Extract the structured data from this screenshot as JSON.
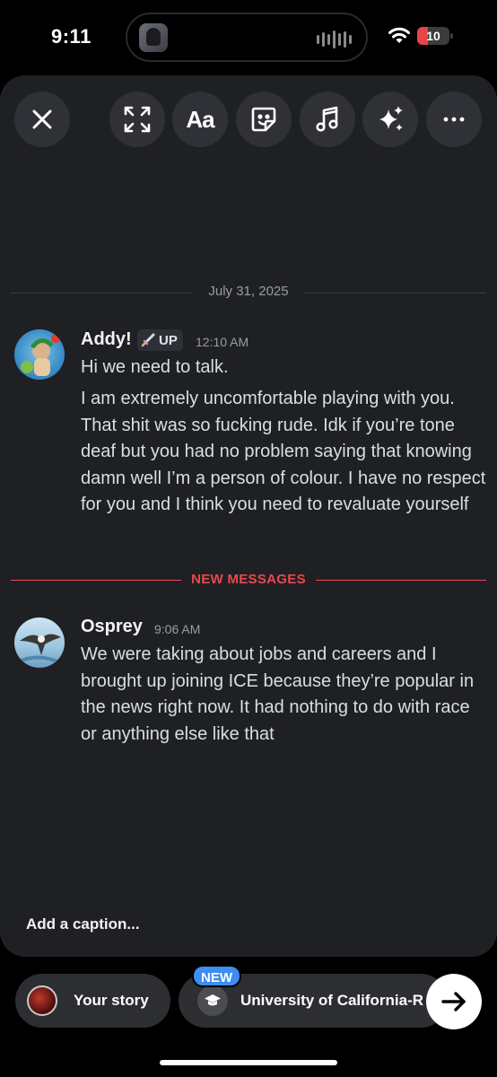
{
  "status_bar": {
    "time": "9:11",
    "battery_level": "10",
    "battery_color": "#e64646"
  },
  "toolbar": {
    "close_icon": "close-icon",
    "resize_icon": "expand-icon",
    "text_label": "Aa",
    "sticker_icon": "sticker-icon",
    "music_icon": "music-note-icon",
    "effects_icon": "sparkles-icon",
    "more_icon": "more-icon"
  },
  "chat": {
    "date_divider": "July 31, 2025",
    "new_messages_divider": "NEW MESSAGES",
    "messages": [
      {
        "username": "Addy!",
        "badge": "UP",
        "time": "12:10 AM",
        "lines": [
          "Hi we need to talk.",
          "I am extremely uncomfortable playing with you. That shit was so fucking rude. Idk if you’re tone deaf but you had no problem saying that knowing damn well I’m a person of colour. I have no respect for you and I think you need to revaluate yourself"
        ]
      },
      {
        "username": "Osprey",
        "time": "9:06 AM",
        "lines": [
          "We were taking about jobs and careers and I brought up joining ICE because they’re popular in the news right now. It had nothing to do with race or anything else like that"
        ]
      }
    ]
  },
  "caption_placeholder": "Add a caption...",
  "share": {
    "your_story_label": "Your story",
    "new_badge": "NEW",
    "community_label": "University of California-R"
  },
  "colors": {
    "card_bg": "#1f2024",
    "accent_new": "#3d8ef0",
    "new_messages_red": "#e8494d"
  }
}
